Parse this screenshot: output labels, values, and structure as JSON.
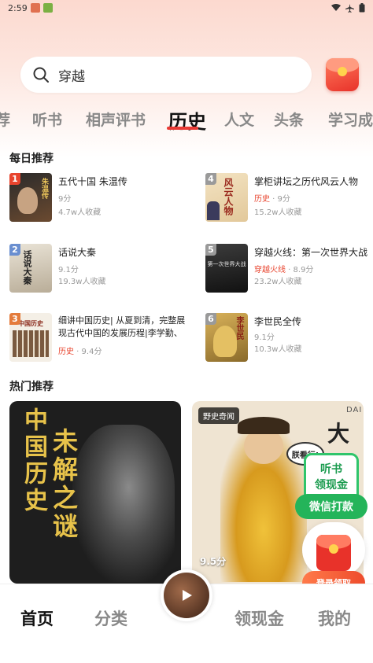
{
  "status_bar": {
    "time": "2:59"
  },
  "search": {
    "text": "穿越"
  },
  "tabs": [
    {
      "label": "荐",
      "active": false
    },
    {
      "label": "听书",
      "active": false
    },
    {
      "label": "相声评书",
      "active": false
    },
    {
      "label": "历史",
      "active": true
    },
    {
      "label": "人文",
      "active": false
    },
    {
      "label": "头条",
      "active": false
    },
    {
      "label": "学习成",
      "active": false
    }
  ],
  "daily": {
    "title": "每日推荐",
    "items": [
      {
        "rank": "1",
        "title": "五代十国 朱温传",
        "score": "9分",
        "stat": "4.7w人收藏",
        "cover_text": "朱温传"
      },
      {
        "rank": "4",
        "title": "掌柜讲坛之历代风云人物",
        "tag": "历史",
        "score": "9分",
        "stat": "15.2w人收藏",
        "cover_text": "风云人物"
      },
      {
        "rank": "2",
        "title": "话说大秦",
        "score": "9.1分",
        "stat": "19.3w人收藏",
        "cover_text": "话说大秦"
      },
      {
        "rank": "5",
        "title": "穿越火线：第一次世界大战",
        "tag": "穿越火线",
        "score": "8.9分",
        "stat": "23.2w人收藏",
        "cover_text": "第一次世界大战"
      },
      {
        "rank": "3",
        "title": "细讲中国历史| 从夏到清，完整展现古代中国的发展历程|李学勤、",
        "tag": "历史",
        "score": "9.4分",
        "cover_text": "中国历史"
      },
      {
        "rank": "6",
        "title": "李世民全传",
        "score": "9.1分",
        "stat": "10.3w人收藏",
        "cover_text": "李世民"
      }
    ]
  },
  "hot": {
    "title": "热门推荐",
    "cards": [
      {
        "text_left": "中国历史",
        "text_right": "未解之谜"
      },
      {
        "badge": "野史奇闻",
        "score": "9.5分",
        "cover_text": "大九",
        "sub_text": "DAI",
        "bubble": "朕看行!"
      }
    ]
  },
  "floating": {
    "listen_line1": "听书",
    "listen_line2": "领现金",
    "wechat": "微信打款",
    "login": "登录领取"
  },
  "bottom_nav": {
    "home": "首页",
    "category": "分类",
    "cash": "领现金",
    "mine": "我的",
    "player_cover_text": "罗阳行行"
  },
  "colors": {
    "accent_red": "#ea3a34",
    "tag_red": "#e8442e",
    "wechat_green": "#24b45a",
    "rank_1": "#e8442e",
    "rank_2": "#6a8fd0",
    "rank_3": "#e47b3b",
    "rank_other": "#9a9a9a"
  }
}
